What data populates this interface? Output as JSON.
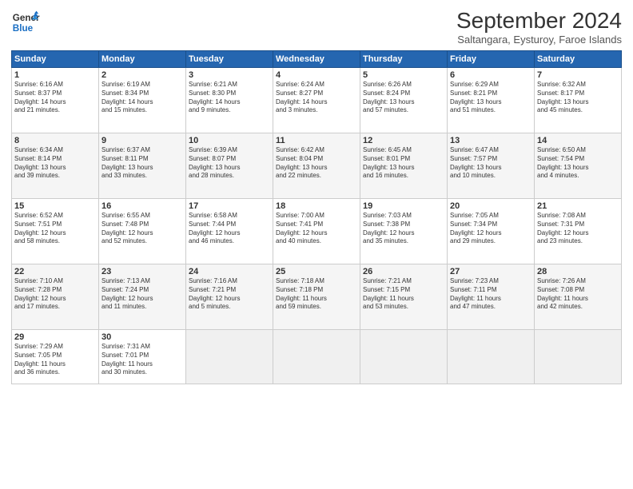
{
  "header": {
    "logo_line1": "General",
    "logo_line2": "Blue",
    "month": "September 2024",
    "location": "Saltangara, Eysturoy, Faroe Islands"
  },
  "weekdays": [
    "Sunday",
    "Monday",
    "Tuesday",
    "Wednesday",
    "Thursday",
    "Friday",
    "Saturday"
  ],
  "weeks": [
    [
      {
        "day": 1,
        "info": "Sunrise: 6:16 AM\nSunset: 8:37 PM\nDaylight: 14 hours\nand 21 minutes."
      },
      {
        "day": 2,
        "info": "Sunrise: 6:19 AM\nSunset: 8:34 PM\nDaylight: 14 hours\nand 15 minutes."
      },
      {
        "day": 3,
        "info": "Sunrise: 6:21 AM\nSunset: 8:30 PM\nDaylight: 14 hours\nand 9 minutes."
      },
      {
        "day": 4,
        "info": "Sunrise: 6:24 AM\nSunset: 8:27 PM\nDaylight: 14 hours\nand 3 minutes."
      },
      {
        "day": 5,
        "info": "Sunrise: 6:26 AM\nSunset: 8:24 PM\nDaylight: 13 hours\nand 57 minutes."
      },
      {
        "day": 6,
        "info": "Sunrise: 6:29 AM\nSunset: 8:21 PM\nDaylight: 13 hours\nand 51 minutes."
      },
      {
        "day": 7,
        "info": "Sunrise: 6:32 AM\nSunset: 8:17 PM\nDaylight: 13 hours\nand 45 minutes."
      }
    ],
    [
      {
        "day": 8,
        "info": "Sunrise: 6:34 AM\nSunset: 8:14 PM\nDaylight: 13 hours\nand 39 minutes."
      },
      {
        "day": 9,
        "info": "Sunrise: 6:37 AM\nSunset: 8:11 PM\nDaylight: 13 hours\nand 33 minutes."
      },
      {
        "day": 10,
        "info": "Sunrise: 6:39 AM\nSunset: 8:07 PM\nDaylight: 13 hours\nand 28 minutes."
      },
      {
        "day": 11,
        "info": "Sunrise: 6:42 AM\nSunset: 8:04 PM\nDaylight: 13 hours\nand 22 minutes."
      },
      {
        "day": 12,
        "info": "Sunrise: 6:45 AM\nSunset: 8:01 PM\nDaylight: 13 hours\nand 16 minutes."
      },
      {
        "day": 13,
        "info": "Sunrise: 6:47 AM\nSunset: 7:57 PM\nDaylight: 13 hours\nand 10 minutes."
      },
      {
        "day": 14,
        "info": "Sunrise: 6:50 AM\nSunset: 7:54 PM\nDaylight: 13 hours\nand 4 minutes."
      }
    ],
    [
      {
        "day": 15,
        "info": "Sunrise: 6:52 AM\nSunset: 7:51 PM\nDaylight: 12 hours\nand 58 minutes."
      },
      {
        "day": 16,
        "info": "Sunrise: 6:55 AM\nSunset: 7:48 PM\nDaylight: 12 hours\nand 52 minutes."
      },
      {
        "day": 17,
        "info": "Sunrise: 6:58 AM\nSunset: 7:44 PM\nDaylight: 12 hours\nand 46 minutes."
      },
      {
        "day": 18,
        "info": "Sunrise: 7:00 AM\nSunset: 7:41 PM\nDaylight: 12 hours\nand 40 minutes."
      },
      {
        "day": 19,
        "info": "Sunrise: 7:03 AM\nSunset: 7:38 PM\nDaylight: 12 hours\nand 35 minutes."
      },
      {
        "day": 20,
        "info": "Sunrise: 7:05 AM\nSunset: 7:34 PM\nDaylight: 12 hours\nand 29 minutes."
      },
      {
        "day": 21,
        "info": "Sunrise: 7:08 AM\nSunset: 7:31 PM\nDaylight: 12 hours\nand 23 minutes."
      }
    ],
    [
      {
        "day": 22,
        "info": "Sunrise: 7:10 AM\nSunset: 7:28 PM\nDaylight: 12 hours\nand 17 minutes."
      },
      {
        "day": 23,
        "info": "Sunrise: 7:13 AM\nSunset: 7:24 PM\nDaylight: 12 hours\nand 11 minutes."
      },
      {
        "day": 24,
        "info": "Sunrise: 7:16 AM\nSunset: 7:21 PM\nDaylight: 12 hours\nand 5 minutes."
      },
      {
        "day": 25,
        "info": "Sunrise: 7:18 AM\nSunset: 7:18 PM\nDaylight: 11 hours\nand 59 minutes."
      },
      {
        "day": 26,
        "info": "Sunrise: 7:21 AM\nSunset: 7:15 PM\nDaylight: 11 hours\nand 53 minutes."
      },
      {
        "day": 27,
        "info": "Sunrise: 7:23 AM\nSunset: 7:11 PM\nDaylight: 11 hours\nand 47 minutes."
      },
      {
        "day": 28,
        "info": "Sunrise: 7:26 AM\nSunset: 7:08 PM\nDaylight: 11 hours\nand 42 minutes."
      }
    ],
    [
      {
        "day": 29,
        "info": "Sunrise: 7:29 AM\nSunset: 7:05 PM\nDaylight: 11 hours\nand 36 minutes."
      },
      {
        "day": 30,
        "info": "Sunrise: 7:31 AM\nSunset: 7:01 PM\nDaylight: 11 hours\nand 30 minutes."
      },
      null,
      null,
      null,
      null,
      null
    ]
  ]
}
